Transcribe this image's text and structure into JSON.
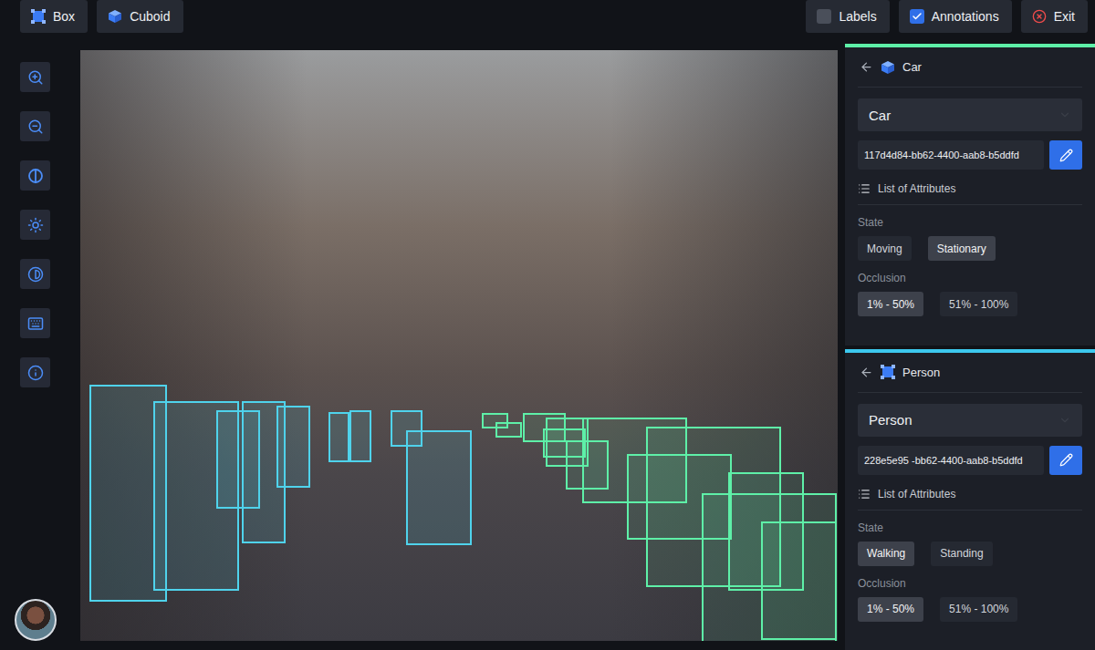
{
  "toolbar": {
    "tools": [
      {
        "label": "Box",
        "kind": "box"
      },
      {
        "label": "Cuboid",
        "kind": "cuboid"
      }
    ],
    "toggles": [
      {
        "label": "Labels",
        "checked": false
      },
      {
        "label": "Annotations",
        "checked": true
      }
    ],
    "exit": "Exit"
  },
  "annotations": [
    {
      "kind": "box",
      "color": "#4fd3ec"
    },
    {
      "kind": "box",
      "color": "#4fd3ec"
    },
    {
      "kind": "box",
      "color": "#4fd3ec"
    },
    {
      "kind": "box",
      "color": "#4fd3ec"
    },
    {
      "kind": "box",
      "color": "#4fd3ec"
    },
    {
      "kind": "box",
      "color": "#4fd3ec"
    },
    {
      "kind": "box",
      "color": "#4fd3ec"
    },
    {
      "kind": "box",
      "color": "#4fd3ec"
    },
    {
      "kind": "box",
      "color": "#4fd3ec"
    },
    {
      "kind": "cuboid",
      "color": "#5ef0a8"
    },
    {
      "kind": "cuboid",
      "color": "#5ef0a8"
    },
    {
      "kind": "cuboid",
      "color": "#5ef0a8"
    },
    {
      "kind": "cuboid",
      "color": "#5ef0a8"
    },
    {
      "kind": "cuboid",
      "color": "#5ef0a8"
    },
    {
      "kind": "cuboid",
      "color": "#5ef0a8"
    }
  ],
  "panels": [
    {
      "title": "Car",
      "kind": "cuboid",
      "color": "#5ef0a8",
      "class_value": "Car",
      "id": "117d4d84-bb62-4400-aab8-b5ddfd",
      "attributes_title": "List of Attributes",
      "groups": [
        {
          "label": "State",
          "options": [
            {
              "label": "Moving",
              "selected": false
            },
            {
              "label": "Stationary",
              "selected": true
            }
          ]
        },
        {
          "label": "Occlusion",
          "options": [
            {
              "label": "1% - 50%",
              "selected": true
            },
            {
              "label": "51% - 100%",
              "selected": false
            }
          ]
        }
      ]
    },
    {
      "title": "Person",
      "kind": "box",
      "color": "#3cc8ee",
      "class_value": "Person",
      "id": "228e5e95 -bb62-4400-aab8-b5ddfd",
      "attributes_title": "List of Attributes",
      "groups": [
        {
          "label": "State",
          "options": [
            {
              "label": "Walking",
              "selected": true
            },
            {
              "label": "Standing",
              "selected": false
            }
          ]
        },
        {
          "label": "Occlusion",
          "options": [
            {
              "label": "1% - 50%",
              "selected": true
            },
            {
              "label": "51% - 100%",
              "selected": false
            }
          ]
        }
      ]
    }
  ]
}
